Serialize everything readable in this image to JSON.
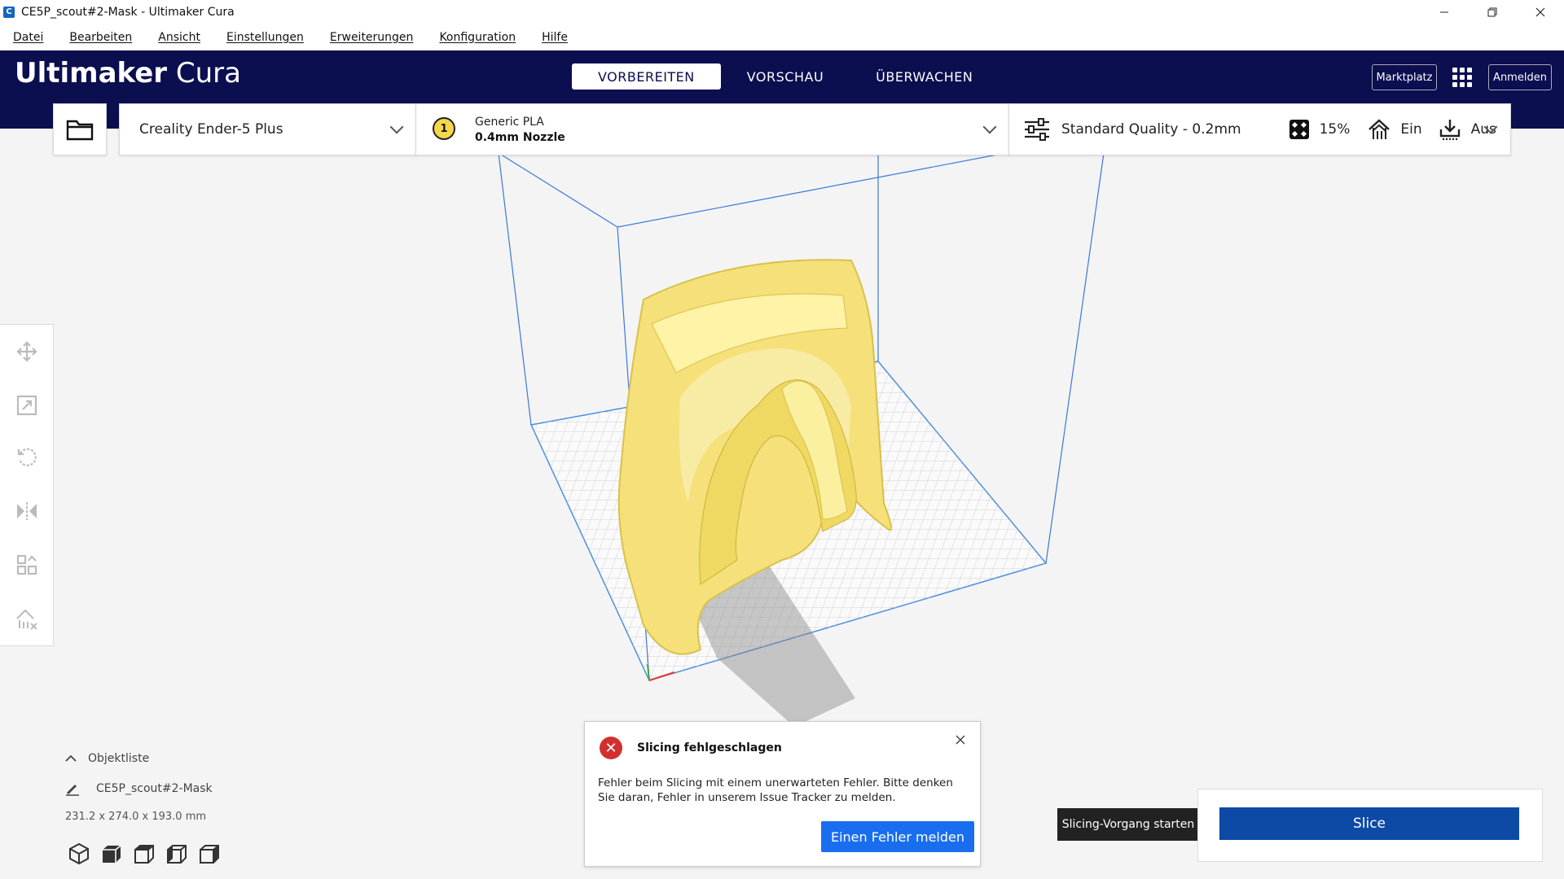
{
  "window": {
    "title": "CE5P_scout#2-Mask - Ultimaker Cura",
    "app_icon_letter": "C"
  },
  "menu": {
    "items": [
      "Datei",
      "Bearbeiten",
      "Ansicht",
      "Einstellungen",
      "Erweiterungen",
      "Konfiguration",
      "Hilfe"
    ]
  },
  "header": {
    "logo_bold": "Ultimaker",
    "logo_light": "Cura",
    "tabs": [
      {
        "label": "VORBEREITEN",
        "active": true
      },
      {
        "label": "VORSCHAU",
        "active": false
      },
      {
        "label": "ÜBERWACHEN",
        "active": false
      }
    ],
    "marketplace_label": "Marktplatz",
    "signin_label": "Anmelden"
  },
  "printer": {
    "name": "Creality Ender-5 Plus"
  },
  "material": {
    "extruder_number": "1",
    "name": "Generic PLA",
    "nozzle": "0.4mm Nozzle"
  },
  "print_settings": {
    "profile": "Standard Quality - 0.2mm",
    "infill": "15%",
    "support": "Ein",
    "adhesion": "Aus"
  },
  "object_list": {
    "header": "Objektliste",
    "object_name": "CE5P_scout#2-Mask",
    "dimensions": "231.2 x 274.0 x 193.0 mm"
  },
  "error": {
    "title": "Slicing fehlgeschlagen",
    "body": "Fehler beim Slicing mit einem unerwarteten Fehler. Bitte denken Sie daran, Fehler in unserem Issue Tracker zu melden.",
    "button": "Einen Fehler melden"
  },
  "slice": {
    "tooltip": "Slicing-Vorgang starten",
    "button": "Slice"
  },
  "colors": {
    "header_bg": "#0b0e4f",
    "accent_blue": "#196ef0",
    "slice_blue": "#0c4aa6",
    "model_yellow": "#f6e27a",
    "error_red": "#d32f2f"
  }
}
